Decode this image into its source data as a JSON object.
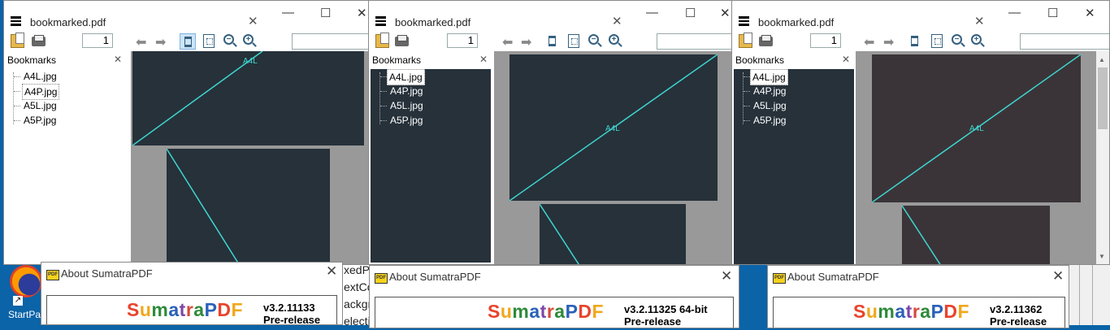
{
  "colors": {
    "brand": [
      "#e8432c",
      "#f0a81c",
      "#2e8a3a",
      "#2a61b8",
      "#7b46a8",
      "#d54a3a",
      "#2e8a3a",
      "#2a61b8",
      "#e8432c",
      "#f0a81c",
      "#2e8a3a"
    ],
    "page_dark": "#26313a",
    "page_mauve": "#3a3438",
    "accent_line": "#3fd6d0"
  },
  "desktop": {
    "icon_label": "StartPa"
  },
  "bg_window": {
    "lines": [
      "xedP",
      "extCo",
      "ackgr",
      "electi"
    ]
  },
  "windows": [
    {
      "title": "bookmarked.pdf",
      "page_number": "1",
      "bookmarks_title": "Bookmarks",
      "bookmarks": [
        "A4L.jpg",
        "A4P.jpg",
        "A5L.jpg",
        "A5P.jpg"
      ],
      "page_label": "A4L"
    },
    {
      "title": "bookmarked.pdf",
      "page_number": "1",
      "bookmarks_title": "Bookmarks",
      "bookmarks": [
        "A4L.jpg",
        "A4P.jpg",
        "A5L.jpg",
        "A5P.jpg"
      ],
      "page_label": "A4L"
    },
    {
      "title": "bookmarked.pdf",
      "page_number": "1",
      "bookmarks_title": "Bookmarks",
      "bookmarks": [
        "A4L.jpg",
        "A4P.jpg",
        "A5L.jpg",
        "A5P.jpg"
      ],
      "page_label": "A4L"
    }
  ],
  "about_dialogs": [
    {
      "title": "About SumatraPDF",
      "brand": "SumatraPDF",
      "version": "v3.2.11133",
      "release": "Pre-release"
    },
    {
      "title": "About SumatraPDF",
      "brand": "SumatraPDF",
      "version": "v3.2.11325 64-bit",
      "release": "Pre-release"
    },
    {
      "title": "About SumatraPDF",
      "brand": "SumatraPDF",
      "version": "v3.2.11362",
      "release": "Pre-release"
    }
  ],
  "icons": {
    "menu": "hamburger-menu-icon",
    "open": "open-file-icon",
    "print": "print-icon",
    "prev": "previous-page-icon",
    "next": "next-page-icon",
    "fit_page": "fit-page-icon",
    "fit_content": "fit-content-icon",
    "zoom_out": "zoom-out-icon",
    "zoom_in": "zoom-in-icon",
    "close": "close-icon",
    "minimize": "minimize-icon",
    "maximize": "maximize-icon"
  }
}
